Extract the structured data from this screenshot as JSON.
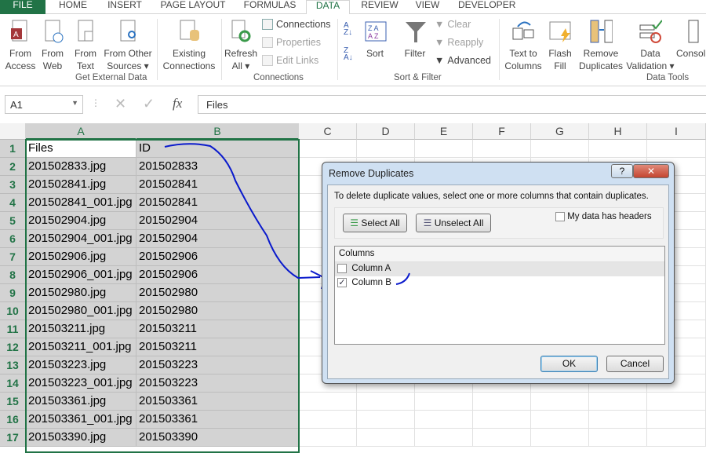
{
  "tabs": [
    "FILE",
    "HOME",
    "INSERT",
    "PAGE LAYOUT",
    "FORMULAS",
    "DATA",
    "REVIEW",
    "VIEW",
    "DEVELOPER"
  ],
  "ribbon": {
    "get_external": {
      "label": "Get External Data",
      "from_access": [
        "From",
        "Access"
      ],
      "from_web": [
        "From",
        "Web"
      ],
      "from_text": [
        "From",
        "Text"
      ],
      "from_other": [
        "From Other",
        "Sources ▾"
      ],
      "existing": [
        "Existing",
        "Connections"
      ]
    },
    "connections": {
      "label": "Connections",
      "refresh": [
        "Refresh",
        "All ▾"
      ],
      "connections": "Connections",
      "properties": "Properties",
      "edit_links": "Edit Links"
    },
    "sort_filter": {
      "label": "Sort & Filter",
      "sort": "Sort",
      "filter": "Filter",
      "clear": "Clear",
      "reapply": "Reapply",
      "advanced": "Advanced"
    },
    "data_tools": {
      "label": "Data Tools",
      "text_to_columns": [
        "Text to",
        "Columns"
      ],
      "flash_fill": [
        "Flash",
        "Fill"
      ],
      "remove_duplicates": [
        "Remove",
        "Duplicates"
      ],
      "data_validation": [
        "Data",
        "Validation ▾"
      ],
      "consolidate": "Consol"
    }
  },
  "formula_bar": {
    "name_box": "A1",
    "fx": "fx",
    "value": "Files"
  },
  "columns": [
    "A",
    "B",
    "C",
    "D",
    "E",
    "F",
    "G",
    "H",
    "I"
  ],
  "rows": [
    [
      "1",
      "Files",
      "ID"
    ],
    [
      "2",
      "201502833.jpg",
      "201502833"
    ],
    [
      "3",
      "201502841.jpg",
      "201502841"
    ],
    [
      "4",
      "201502841_001.jpg",
      "201502841"
    ],
    [
      "5",
      "201502904.jpg",
      "201502904"
    ],
    [
      "6",
      "201502904_001.jpg",
      "201502904"
    ],
    [
      "7",
      "201502906.jpg",
      "201502906"
    ],
    [
      "8",
      "201502906_001.jpg",
      "201502906"
    ],
    [
      "9",
      "201502980.jpg",
      "201502980"
    ],
    [
      "10",
      "201502980_001.jpg",
      "201502980"
    ],
    [
      "11",
      "201503211.jpg",
      "201503211"
    ],
    [
      "12",
      "201503211_001.jpg",
      "201503211"
    ],
    [
      "13",
      "201503223.jpg",
      "201503223"
    ],
    [
      "14",
      "201503223_001.jpg",
      "201503223"
    ],
    [
      "15",
      "201503361.jpg",
      "201503361"
    ],
    [
      "16",
      "201503361_001.jpg",
      "201503361"
    ],
    [
      "17",
      "201503390.jpg",
      "201503390"
    ]
  ],
  "dialog": {
    "title": "Remove Duplicates",
    "help": "?",
    "close": "✕",
    "instructions": "To delete duplicate values, select one or more columns that contain duplicates.",
    "select_all": "Select All",
    "unselect_all": "Unselect All",
    "headers_label": "My data has headers",
    "headers_checked": false,
    "columns_header": "Columns",
    "items": [
      {
        "label": "Column A",
        "checked": false
      },
      {
        "label": "Column B",
        "checked": true
      }
    ],
    "ok": "OK",
    "cancel": "Cancel"
  },
  "colors": {
    "accent": "#217346",
    "annotation": "#0a1acc"
  }
}
